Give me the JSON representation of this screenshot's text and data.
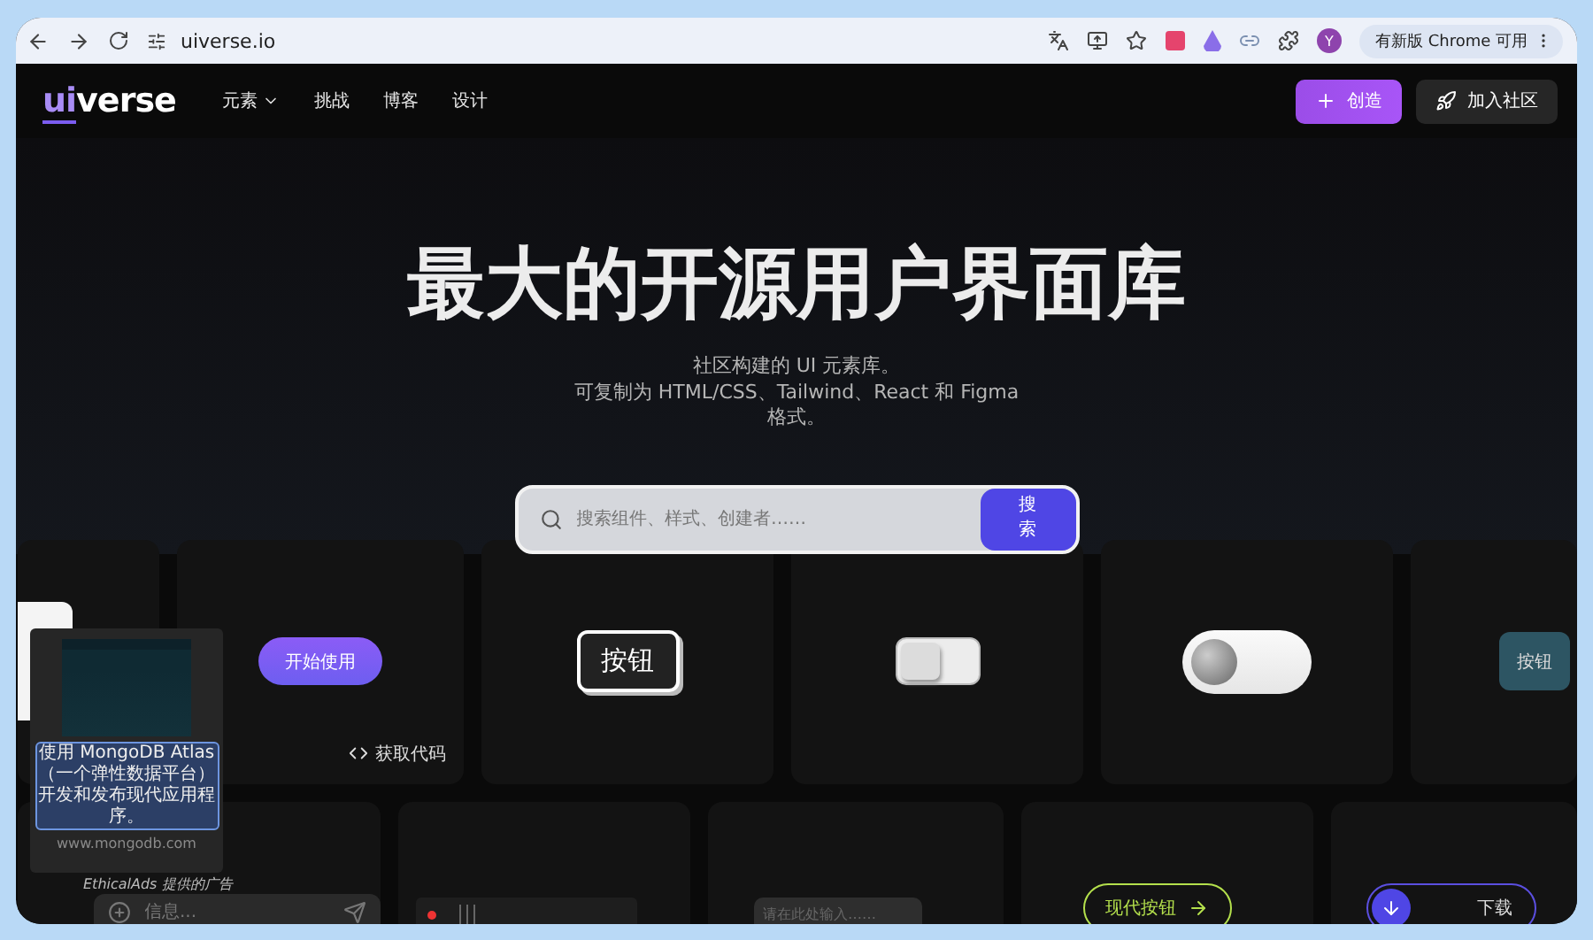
{
  "browser": {
    "url": "uiverse.io",
    "profile": "Y",
    "update_label": "有新版 Chrome 可用"
  },
  "nav": {
    "logo_accent": "ui",
    "logo_rest": "verse",
    "items": [
      {
        "label": "元素",
        "has_menu": true
      },
      {
        "label": "挑战",
        "has_menu": false
      },
      {
        "label": "博客",
        "has_menu": false
      },
      {
        "label": "设计",
        "has_menu": false
      }
    ],
    "create_button": "创造",
    "join_button": "加入社区"
  },
  "hero": {
    "title": "最大的开源用户界面库",
    "subtitle": "社区构建的 UI 元素库。",
    "description": "可复制为 HTML/CSS、Tailwind、React 和 Figma 格式。"
  },
  "search": {
    "placeholder": "搜索组件、样式、创建者……",
    "button": "搜索"
  },
  "cards_row_1": [
    {
      "kind": "partial"
    },
    {
      "kind": "cta",
      "label": "开始使用",
      "footer": "获取代码"
    },
    {
      "kind": "outlined",
      "label": "按钮"
    },
    {
      "kind": "square-switch",
      "on": false
    },
    {
      "kind": "ball-toggle",
      "on": false
    },
    {
      "kind": "teal",
      "label": "按钮"
    }
  ],
  "cards_row_2": [
    {
      "kind": "chat-input",
      "placeholder": "信息..."
    },
    {
      "kind": "player"
    },
    {
      "kind": "text-input",
      "placeholder": "请在此处输入……"
    },
    {
      "kind": "arrow-button",
      "label": "现代按钮"
    },
    {
      "kind": "download",
      "label": "下载"
    }
  ],
  "ad": {
    "text": "使用 MongoDB Atlas（一个弹性数据平台）开发和发布现代应用程序。",
    "domain": "www.mongodb.com",
    "credit": "EthicalAds 提供的广告"
  }
}
